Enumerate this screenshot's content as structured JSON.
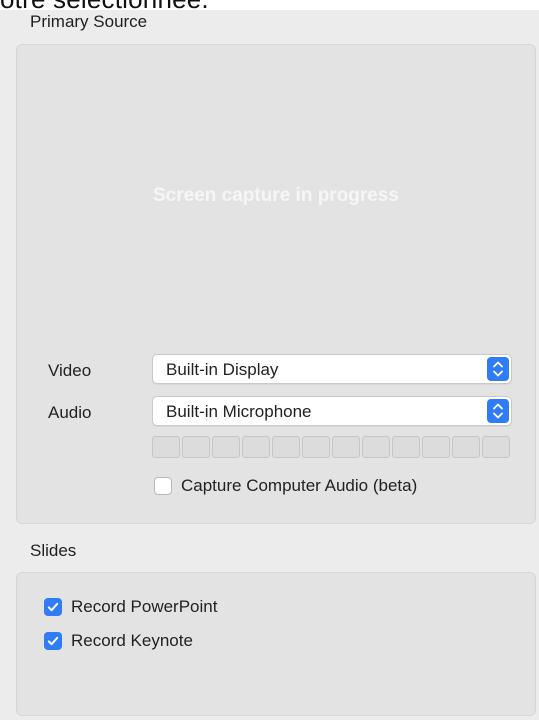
{
  "top_clipped_text": "otre sélectionnée.",
  "primary_source": {
    "title": "Primary Source",
    "preview_text": "Screen capture in progress",
    "video": {
      "label": "Video",
      "value": "Built-in Display"
    },
    "audio": {
      "label": "Audio",
      "value": "Built-in Microphone"
    },
    "audio_level_segments": 12,
    "capture_computer_audio": {
      "label": "Capture Computer Audio (beta)",
      "checked": false
    }
  },
  "slides": {
    "title": "Slides",
    "record_powerpoint": {
      "label": "Record PowerPoint",
      "checked": true
    },
    "record_keynote": {
      "label": "Record Keynote",
      "checked": true
    }
  },
  "colors": {
    "accent": "#2f7cf6",
    "panel": "#e3e3e3",
    "background": "#ececec"
  }
}
